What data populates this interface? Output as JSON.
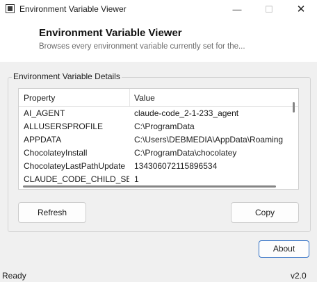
{
  "window": {
    "title": "Environment Variable Viewer",
    "minimize_glyph": "—",
    "maximize_glyph": "☐",
    "close_glyph": "✕"
  },
  "header": {
    "title": "Environment Variable Viewer",
    "subtitle": "Browses every environment variable currently set for the..."
  },
  "group": {
    "legend": "Environment Variable Details"
  },
  "table": {
    "columns": [
      "Property",
      "Value"
    ],
    "rows": [
      {
        "property": "AI_AGENT",
        "value": "claude-code_2-1-233_agent"
      },
      {
        "property": "ALLUSERSPROFILE",
        "value": "C:\\ProgramData"
      },
      {
        "property": "APPDATA",
        "value": "C:\\Users\\DEBMEDIA\\AppData\\Roaming"
      },
      {
        "property": "ChocolateyInstall",
        "value": "C:\\ProgramData\\chocolatey"
      },
      {
        "property": "ChocolateyLastPathUpdate",
        "value": "134306072115896534"
      },
      {
        "property": "CLAUDE_CODE_CHILD_SES...",
        "value": "1"
      }
    ]
  },
  "buttons": {
    "refresh": "Refresh",
    "copy": "Copy",
    "about": "About"
  },
  "status": {
    "text": "Ready",
    "version": "v2.0"
  },
  "colors": {
    "accent": "#2f6fc5",
    "background": "#f0f0f0",
    "header_bg": "#ffffff"
  }
}
